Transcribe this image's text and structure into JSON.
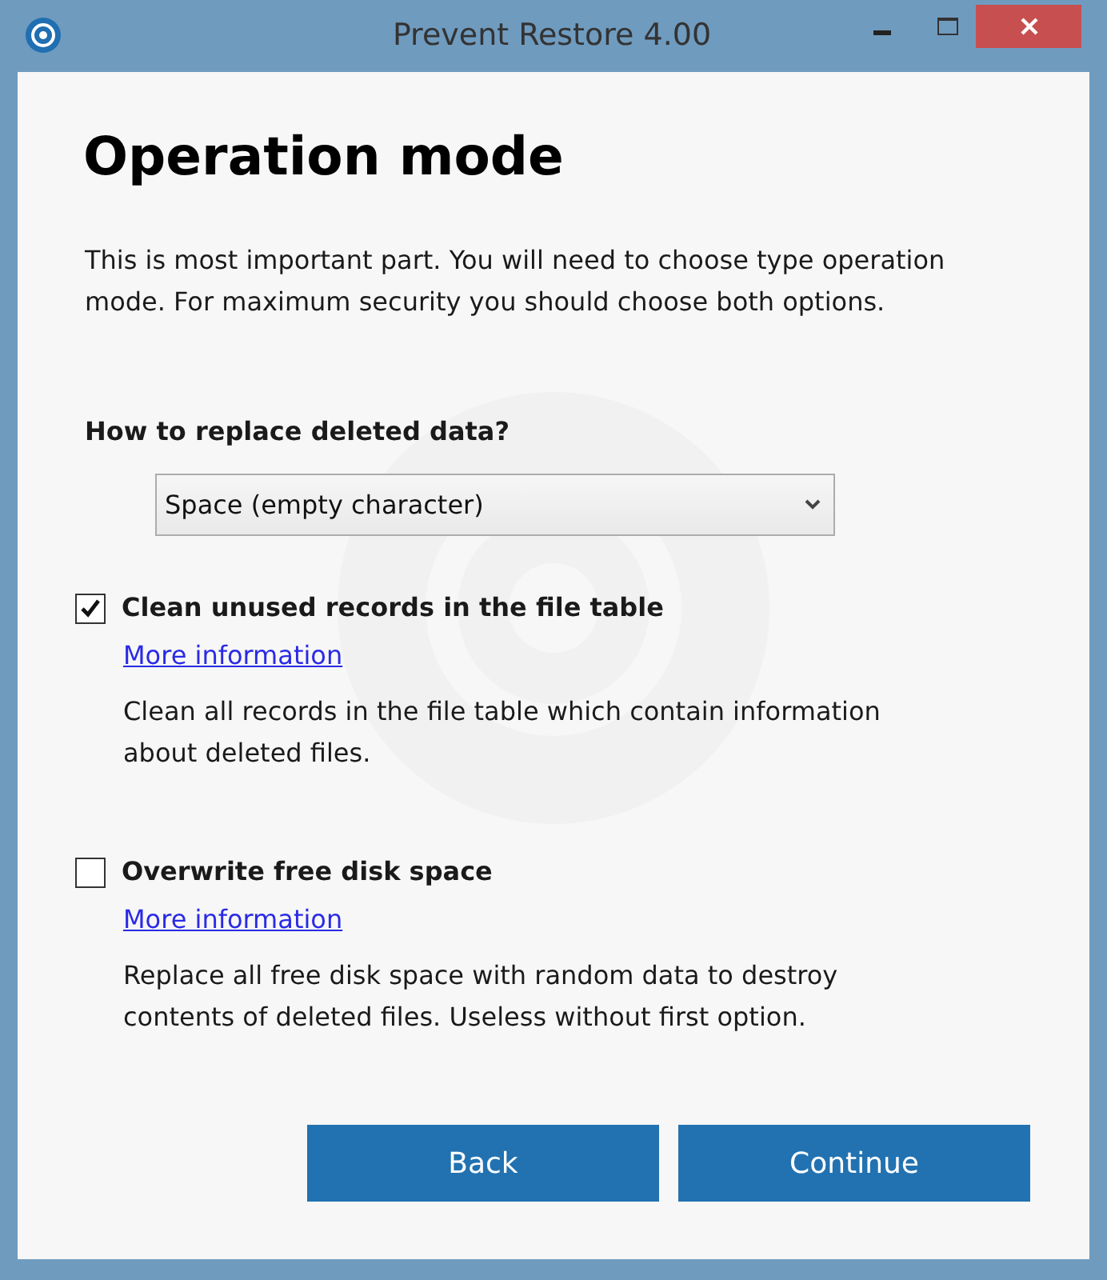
{
  "window": {
    "title": "Prevent Restore 4.00"
  },
  "heading": "Operation mode",
  "intro": "This is most important part. You will need to choose type operation mode. For maximum security you should choose both options.",
  "replace": {
    "label": "How to replace deleted data?",
    "value": "Space (empty character)"
  },
  "options": [
    {
      "label": "Clean unused records in the file table",
      "checked": true,
      "link": "More information",
      "description": "Clean all records in the file table which contain information about deleted files."
    },
    {
      "label": "Overwrite free disk space",
      "checked": false,
      "link": "More information",
      "description": "Replace all free disk space with random data to destroy contents of deleted files. Useless without first option."
    }
  ],
  "buttons": [
    "Back",
    "Continue"
  ]
}
